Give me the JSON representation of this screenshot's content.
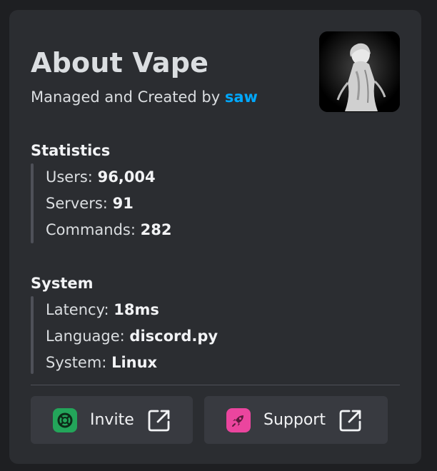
{
  "header": {
    "title": "About Vape",
    "subtitle_prefix": "Managed and Created by",
    "creator": "saw"
  },
  "statistics": {
    "title": "Statistics",
    "rows": [
      {
        "label": "Users:",
        "value": "96,004"
      },
      {
        "label": "Servers:",
        "value": "91"
      },
      {
        "label": "Commands:",
        "value": "282"
      }
    ]
  },
  "system": {
    "title": "System",
    "rows": [
      {
        "label": "Latency:",
        "value": "18ms"
      },
      {
        "label": "Language:",
        "value": "discord.py"
      },
      {
        "label": "System:",
        "value": "Linux"
      }
    ]
  },
  "buttons": {
    "invite": {
      "label": "Invite",
      "icon": "lifebuoy-icon",
      "icon_color": "#23a55a"
    },
    "support": {
      "label": "Support",
      "icon": "rocket-icon",
      "icon_color": "#eb459e"
    },
    "external_icon": "external-link-icon"
  },
  "colors": {
    "background": "#1e1f22",
    "card": "#2b2d31",
    "link": "#00a8fc",
    "button": "#383a40"
  }
}
